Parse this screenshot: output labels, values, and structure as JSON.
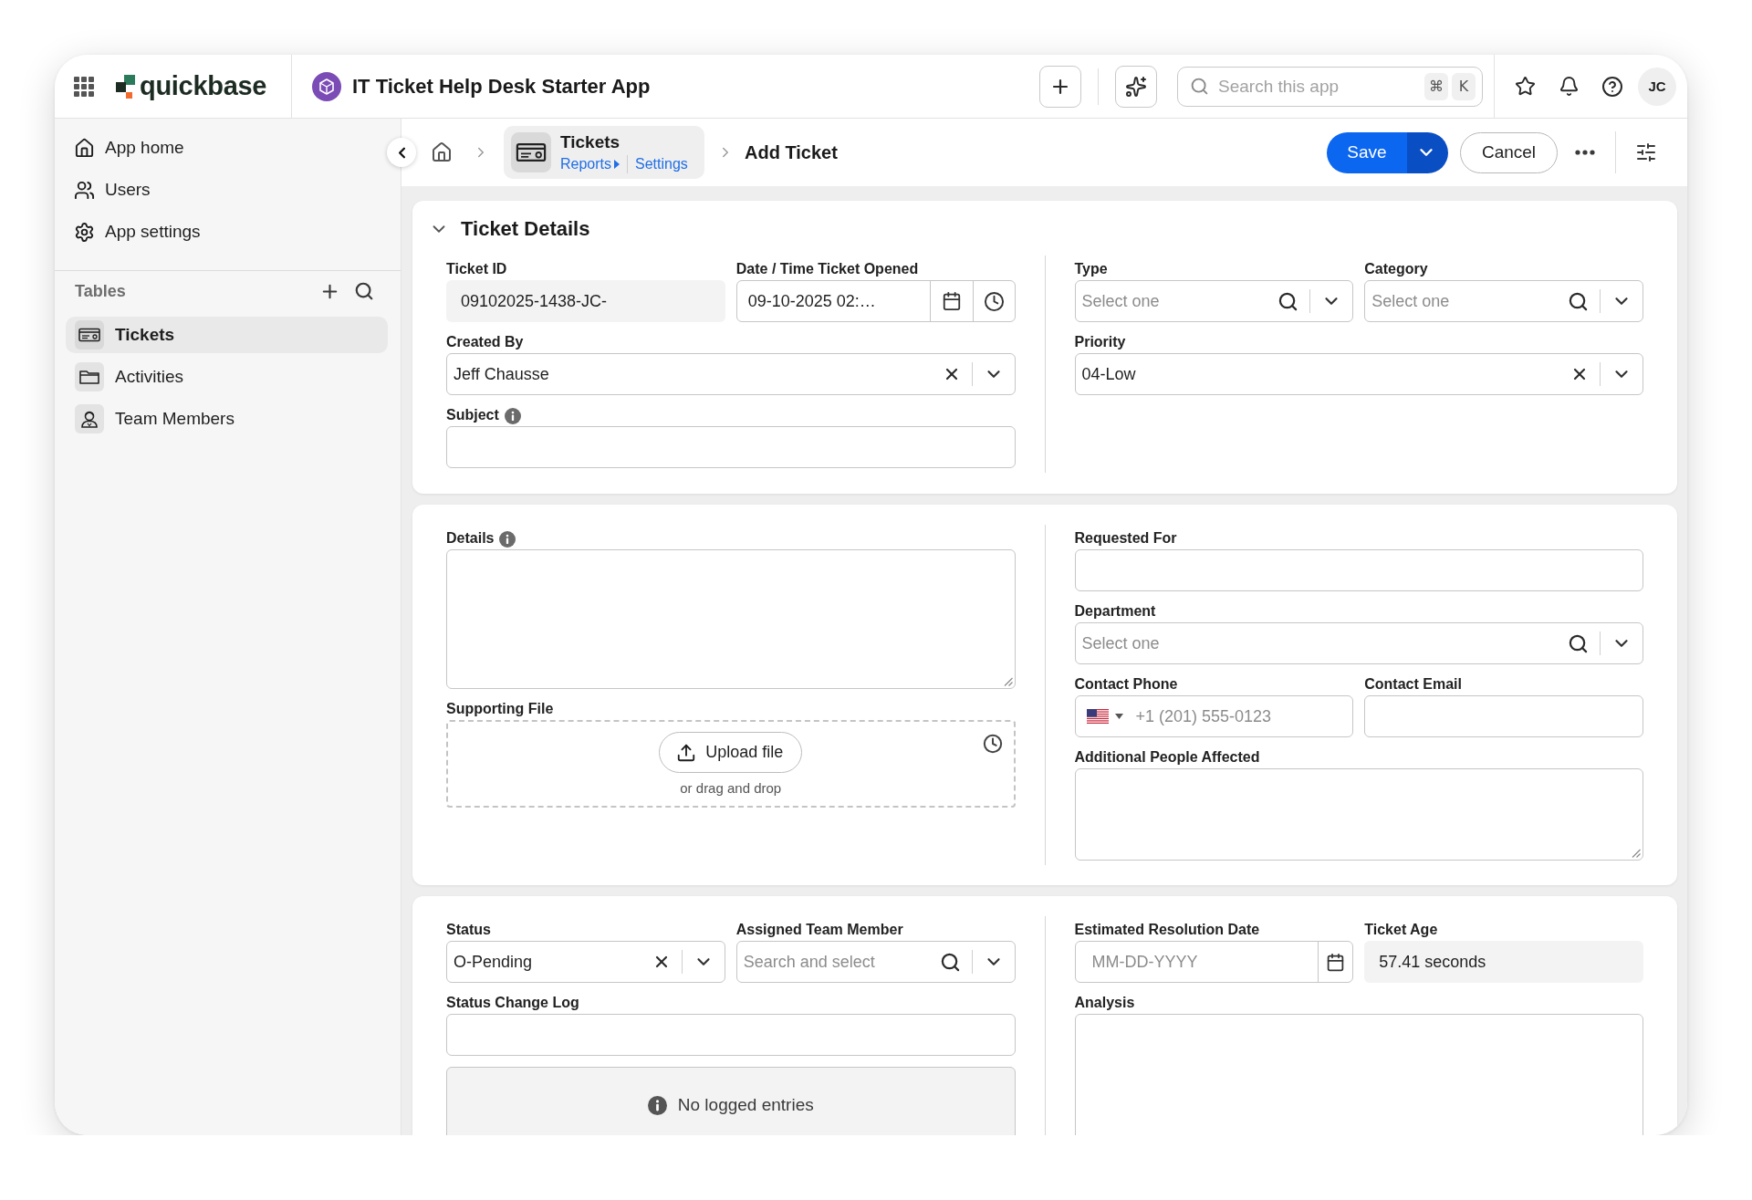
{
  "top_bar": {
    "brand": "quickbase",
    "app_title": "IT Ticket Help Desk Starter App",
    "search": {
      "placeholder": "Search this app",
      "shortcut": [
        "⌘",
        "K"
      ]
    },
    "avatar": "JC"
  },
  "sidebar": {
    "items": [
      {
        "label": "App home"
      },
      {
        "label": "Users"
      },
      {
        "label": "App settings"
      }
    ],
    "tables_heading": "Tables",
    "tables": [
      {
        "label": "Tickets",
        "selected": true
      },
      {
        "label": "Activities",
        "selected": false
      },
      {
        "label": "Team Members",
        "selected": false
      }
    ]
  },
  "breadcrumb": {
    "table": "Tickets",
    "links": [
      {
        "label": "Reports",
        "menu": true
      },
      {
        "label": "Settings",
        "menu": false
      }
    ],
    "current": "Add Ticket"
  },
  "actions": {
    "save": "Save",
    "cancel": "Cancel"
  },
  "sections": [
    {
      "title": "Ticket Details",
      "expanded": true,
      "columns": [
        {
          "rows": [
            [
              {
                "kind": "readonly",
                "label": "Ticket ID",
                "info": false,
                "value": "09102025-1438-JC-"
              },
              {
                "kind": "datetime",
                "label": "Date / Time Ticket Opened",
                "info": false,
                "value": "09-10-2025 02:…"
              }
            ],
            [
              {
                "kind": "select",
                "label": "Created By",
                "info": false,
                "value": "Jeff Chausse",
                "searchable": false
              }
            ],
            [
              {
                "kind": "text",
                "label": "Subject",
                "info": true
              }
            ]
          ]
        },
        {
          "rows": [
            [
              {
                "kind": "select",
                "label": "Type",
                "info": false,
                "placeholder": "Select one",
                "searchable": true
              },
              {
                "kind": "select",
                "label": "Category",
                "info": false,
                "placeholder": "Select one",
                "searchable": true
              }
            ],
            [
              {
                "kind": "select",
                "label": "Priority",
                "info": false,
                "value": "04-Low",
                "searchable": false
              }
            ]
          ]
        }
      ]
    },
    {
      "columns": [
        {
          "rows": [
            [
              {
                "kind": "textarea",
                "label": "Details",
                "info": true
              }
            ],
            [
              {
                "kind": "file",
                "label": "Supporting File",
                "info": false,
                "button": "Upload file",
                "hint": "or drag and drop"
              }
            ]
          ]
        },
        {
          "rows": [
            [
              {
                "kind": "text",
                "label": "Requested For",
                "info": false
              }
            ],
            [
              {
                "kind": "select",
                "label": "Department",
                "info": false,
                "placeholder": "Select one",
                "searchable": true
              }
            ],
            [
              {
                "kind": "phone",
                "label": "Contact Phone",
                "info": false,
                "placeholder": "+1 (201) 555-0123"
              },
              {
                "kind": "text",
                "label": "Contact Email",
                "info": false
              }
            ],
            [
              {
                "kind": "textarea",
                "label": "Additional People Affected",
                "info": false
              }
            ]
          ]
        }
      ]
    },
    {
      "columns": [
        {
          "rows": [
            [
              {
                "kind": "select",
                "label": "Status",
                "info": false,
                "value": "O-Pending",
                "searchable": false
              },
              {
                "kind": "select",
                "label": "Assigned Team Member",
                "info": false,
                "placeholder": "Search and select",
                "searchable": true
              }
            ],
            [
              {
                "kind": "log",
                "label": "Status Change Log",
                "info": false,
                "message": "No logged entries"
              }
            ]
          ]
        },
        {
          "rows": [
            [
              {
                "kind": "date",
                "label": "Estimated Resolution Date",
                "info": false,
                "placeholder": "MM-DD-YYYY"
              },
              {
                "kind": "readonly",
                "label": "Ticket Age",
                "info": false,
                "value": "57.41 seconds"
              }
            ],
            [
              {
                "kind": "textarea",
                "label": "Analysis",
                "info": false
              }
            ]
          ]
        }
      ]
    }
  ]
}
